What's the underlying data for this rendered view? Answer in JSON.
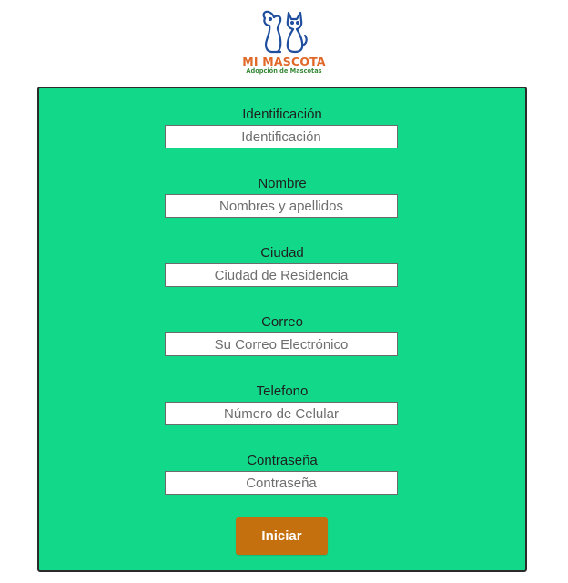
{
  "logo": {
    "title": "MI MASCOTA",
    "subtitle": "Adopción de Mascotas",
    "icon": "dog-and-cat-icon",
    "colors": {
      "icon": "#1f4e9e",
      "title": "#e0692a",
      "subtitle": "#3a8a3a"
    }
  },
  "form": {
    "background_color": "#12d98a",
    "fields": [
      {
        "label": "Identificación",
        "placeholder": "Identificación",
        "value": ""
      },
      {
        "label": "Nombre",
        "placeholder": "Nombres y apellidos",
        "value": ""
      },
      {
        "label": "Ciudad",
        "placeholder": "Ciudad de Residencia",
        "value": ""
      },
      {
        "label": "Correo",
        "placeholder": "Su Correo Electrónico",
        "value": ""
      },
      {
        "label": "Telefono",
        "placeholder": "Número de Celular",
        "value": ""
      },
      {
        "label": "Contraseña",
        "placeholder": "Contraseña",
        "value": ""
      }
    ],
    "submit_label": "Iniciar",
    "submit_color": "#c5700e"
  }
}
